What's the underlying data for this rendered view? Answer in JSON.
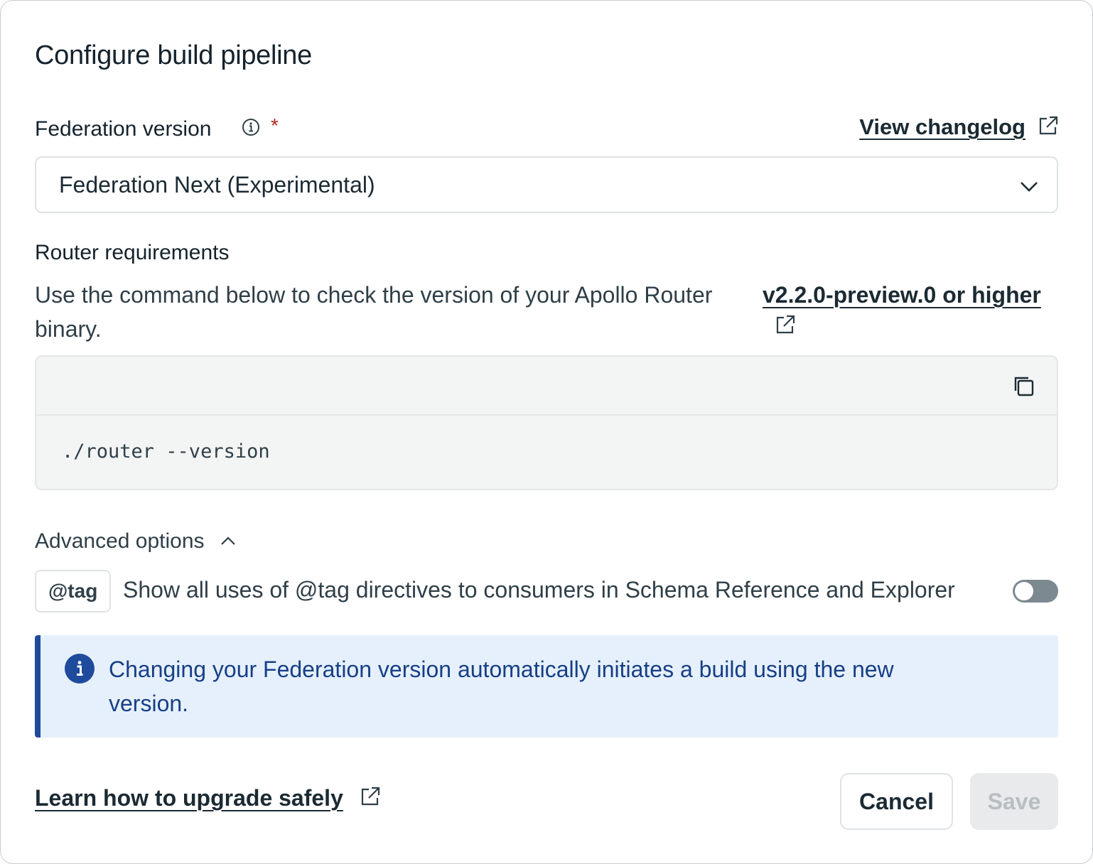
{
  "dialog": {
    "title": "Configure build pipeline"
  },
  "federation": {
    "label": "Federation version",
    "required_mark": "*",
    "changelog_link": "View changelog",
    "selected_value": "Federation Next (Experimental)"
  },
  "router": {
    "title": "Router requirements",
    "desc_before": "Use the command below to check the version of your Apollo Router",
    "version_link": "v2.2.0-preview.0 or higher",
    "desc_after": "binary.",
    "command": "./router --version"
  },
  "advanced": {
    "label": "Advanced options",
    "expanded": true,
    "tag_badge": "@tag",
    "tag_description": "Show all uses of @tag directives to consumers in Schema Reference and Explorer",
    "tag_toggle_on": false
  },
  "banner": {
    "text": "Changing your Federation version automatically initiates a build using the new version."
  },
  "footer": {
    "learn_link": "Learn how to upgrade safely",
    "cancel_label": "Cancel",
    "save_label": "Save",
    "save_disabled": true
  },
  "colors": {
    "banner_accent": "#1f4b9c",
    "banner_bg": "#e6f0fc",
    "required_star": "#b5261e",
    "toggle_off": "#7c8990"
  },
  "icons": {
    "info": "info-icon",
    "external": "external-link-icon",
    "chevron_down": "chevron-down-icon",
    "chevron_up": "chevron-up-icon",
    "copy": "copy-icon",
    "banner_info": "info-circle-filled-icon"
  }
}
